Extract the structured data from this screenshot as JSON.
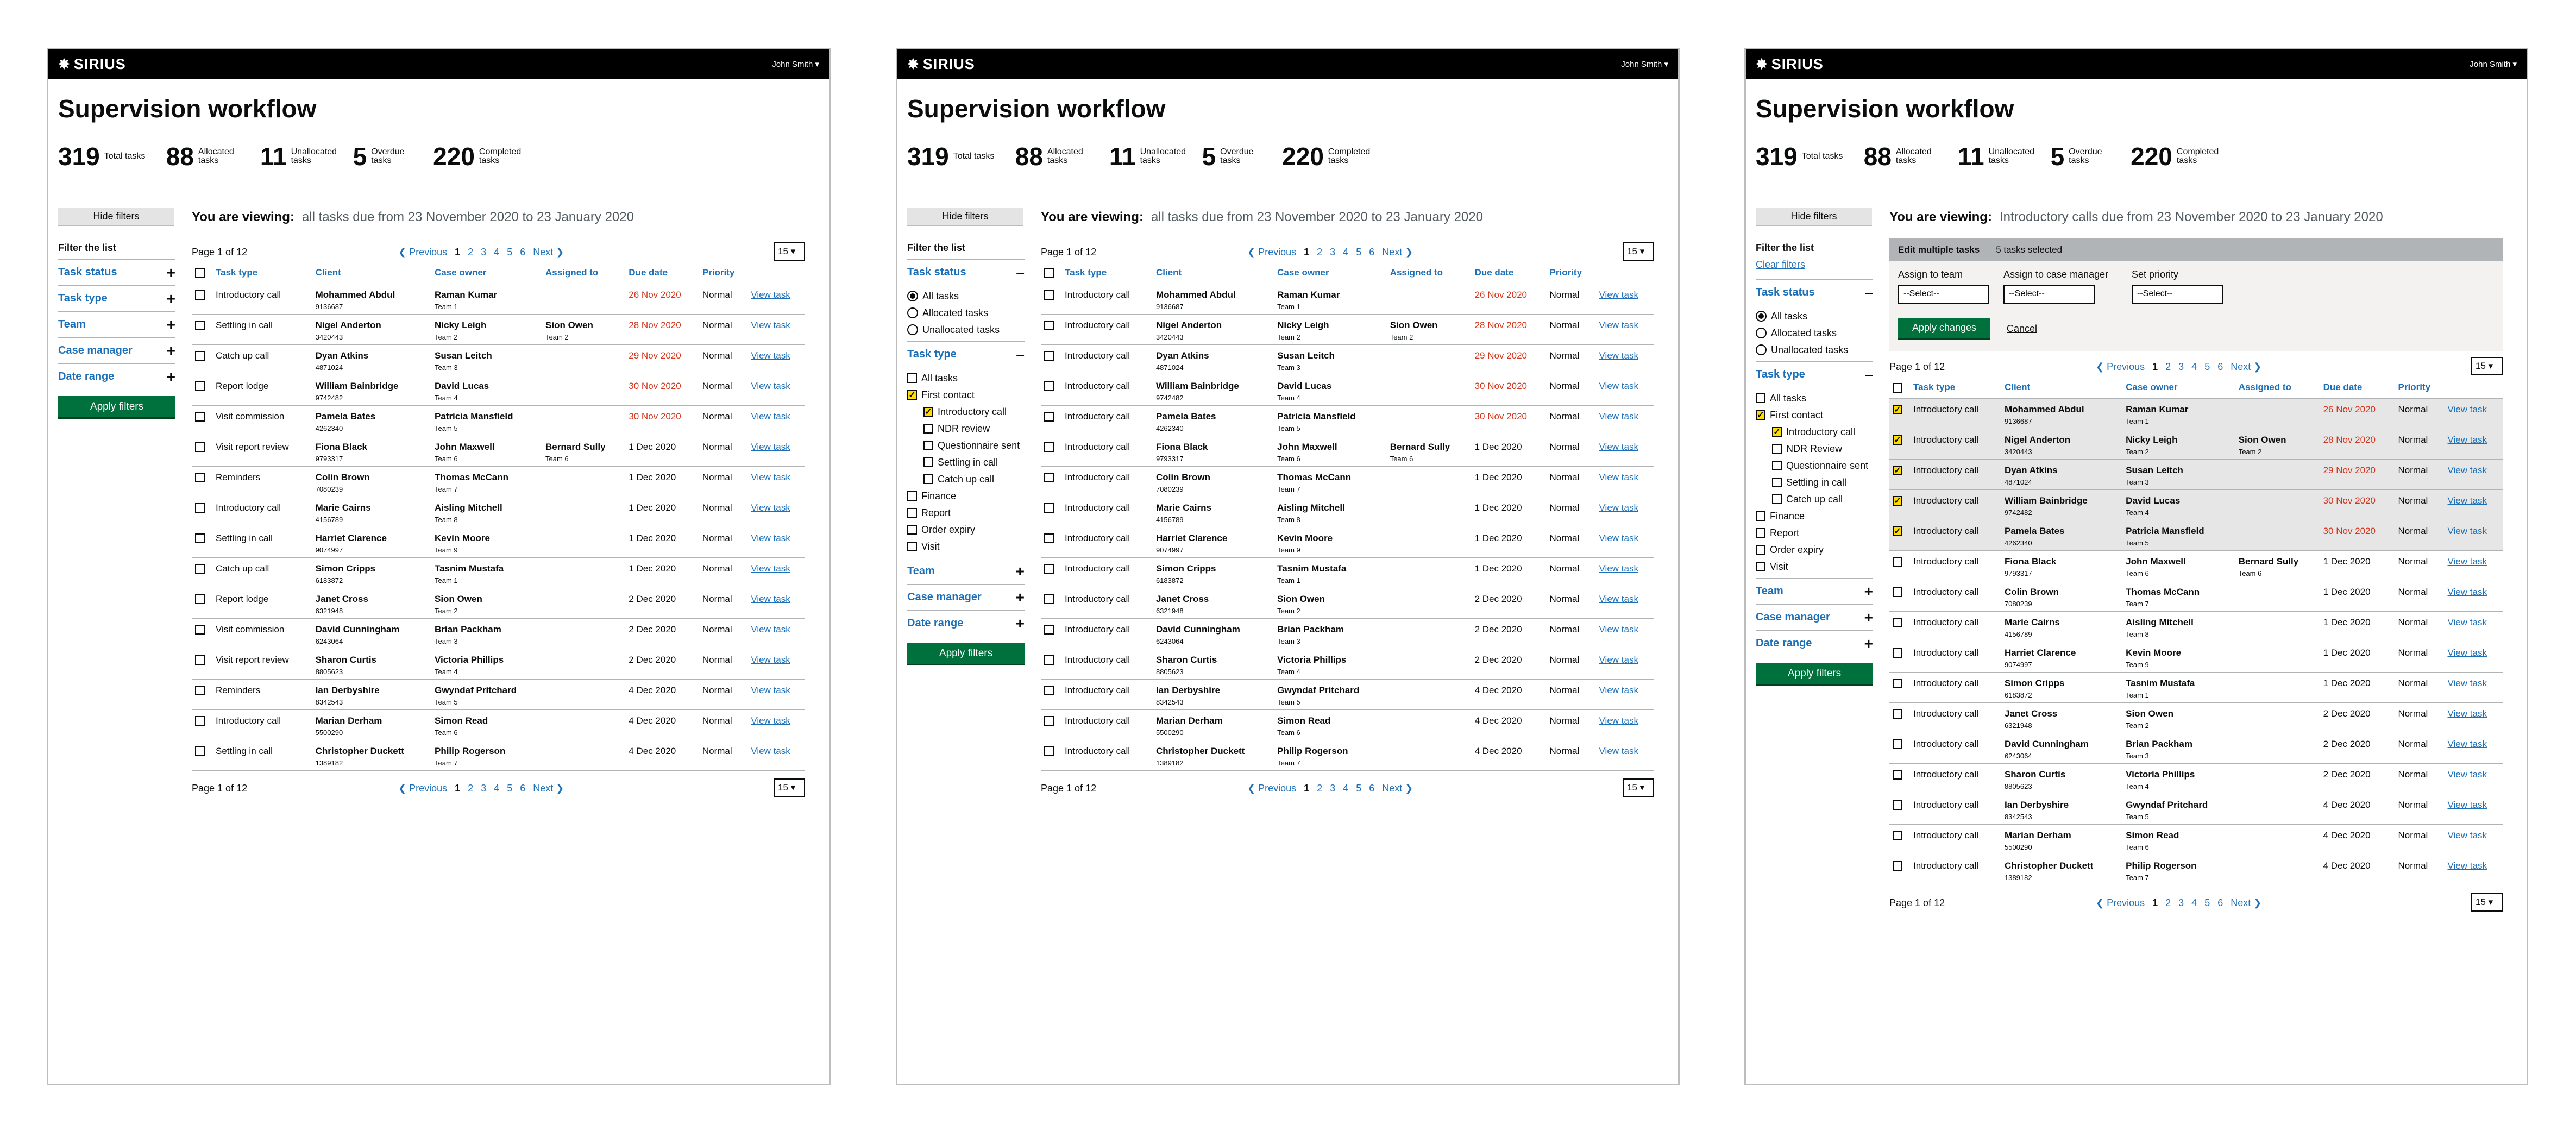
{
  "app": {
    "logo_mark": "✸",
    "logo_text": "SIRIUS",
    "user": "John Smith ▾"
  },
  "page_title": "Supervision workflow",
  "stats": [
    {
      "num": "319",
      "label": "Total tasks"
    },
    {
      "num": "88",
      "label": "Allocated tasks"
    },
    {
      "num": "11",
      "label": "Unallocated tasks"
    },
    {
      "num": "5",
      "label": "Overdue tasks"
    },
    {
      "num": "220",
      "label": "Completed tasks"
    }
  ],
  "hide_filters": "Hide filters",
  "viewing_label": "You are viewing:",
  "viewing_all": "all tasks due from 23 November 2020 to 23 January 2020",
  "viewing_intro": "Introductory calls due from 23 November 2020 to 23 January 2020",
  "filter_title": "Filter the list",
  "clear_filters": "Clear filters",
  "sections": {
    "status": "Task status",
    "type": "Task type",
    "team": "Team",
    "cm": "Case manager",
    "date": "Date range"
  },
  "status_opts": [
    "All tasks",
    "Allocated tasks",
    "Unallocated tasks"
  ],
  "type_opts": {
    "all": "All tasks",
    "first": "First contact",
    "intro": "Introductory call",
    "ndr2": "NDR review",
    "ndr3": "NDR Review",
    "quest": "Questionnaire sent",
    "settle": "Settling in call",
    "catch": "Catch up call",
    "finance": "Finance",
    "report": "Report",
    "order": "Order expiry",
    "visit": "Visit"
  },
  "apply_filters": "Apply filters",
  "pager": {
    "page": "Page 1 of 12",
    "prev": "❮ Previous",
    "pages": [
      "1",
      "2",
      "3",
      "4",
      "5",
      "6"
    ],
    "next": "Next ❯",
    "size": "15 ▾"
  },
  "headers": {
    "type": "Task type",
    "client": "Client",
    "owner": "Case owner",
    "assigned": "Assigned to",
    "due": "Due date",
    "priority": "Priority"
  },
  "view_task": "View task",
  "edit": {
    "title": "Edit multiple tasks",
    "selected": "5 tasks selected",
    "team": "Assign to team",
    "cm": "Assign to case manager",
    "priority": "Set priority",
    "select": "--Select--",
    "apply": "Apply changes",
    "cancel": "Cancel"
  },
  "rows": [
    {
      "type": "Introductory call",
      "client": "Mohammed Abdul",
      "id": "9136687",
      "owner": "Raman Kumar",
      "team": "Team 1",
      "assigned": "",
      "ateam": "",
      "due": "26 Nov 2020",
      "od": true,
      "prio": "Normal"
    },
    {
      "type": "Settling in call",
      "client": "Nigel Anderton",
      "id": "3420443",
      "owner": "Nicky Leigh",
      "team": "Team 2",
      "assigned": "Sion Owen",
      "ateam": "Team 2",
      "due": "28 Nov 2020",
      "od": true,
      "prio": "Normal"
    },
    {
      "type": "Catch up call",
      "client": "Dyan Atkins",
      "id": "4871024",
      "owner": "Susan Leitch",
      "team": "Team 3",
      "assigned": "",
      "ateam": "",
      "due": "29 Nov 2020",
      "od": true,
      "prio": "Normal"
    },
    {
      "type": "Report lodge",
      "client": "William Bainbridge",
      "id": "9742482",
      "owner": "David Lucas",
      "team": "Team 4",
      "assigned": "",
      "ateam": "",
      "due": "30 Nov 2020",
      "od": true,
      "prio": "Normal"
    },
    {
      "type": "Visit commission",
      "client": "Pamela Bates",
      "id": "4262340",
      "owner": "Patricia Mansfield",
      "team": "Team 5",
      "assigned": "",
      "ateam": "",
      "due": "30 Nov 2020",
      "od": true,
      "prio": "Normal"
    },
    {
      "type": "Visit report review",
      "client": "Fiona Black",
      "id": "9793317",
      "owner": "John Maxwell",
      "team": "Team 6",
      "assigned": "Bernard Sully",
      "ateam": "Team 6",
      "due": "1 Dec 2020",
      "od": false,
      "prio": "Normal"
    },
    {
      "type": "Reminders",
      "client": "Colin Brown",
      "id": "7080239",
      "owner": "Thomas McCann",
      "team": "Team 7",
      "assigned": "",
      "ateam": "",
      "due": "1 Dec 2020",
      "od": false,
      "prio": "Normal"
    },
    {
      "type": "Introductory call",
      "client": "Marie Cairns",
      "id": "4156789",
      "owner": "Aisling Mitchell",
      "team": "Team 8",
      "assigned": "",
      "ateam": "",
      "due": "1 Dec 2020",
      "od": false,
      "prio": "Normal"
    },
    {
      "type": "Settling in call",
      "client": "Harriet Clarence",
      "id": "9074997",
      "owner": "Kevin Moore",
      "team": "Team 9",
      "assigned": "",
      "ateam": "",
      "due": "1 Dec 2020",
      "od": false,
      "prio": "Normal"
    },
    {
      "type": "Catch up call",
      "client": "Simon Cripps",
      "id": "6183872",
      "owner": "Tasnim Mustafa",
      "team": "Team 1",
      "assigned": "",
      "ateam": "",
      "due": "1 Dec 2020",
      "od": false,
      "prio": "Normal"
    },
    {
      "type": "Report lodge",
      "client": "Janet Cross",
      "id": "6321948",
      "owner": "Sion Owen",
      "team": "Team 2",
      "assigned": "",
      "ateam": "",
      "due": "2 Dec 2020",
      "od": false,
      "prio": "Normal"
    },
    {
      "type": "Visit commission",
      "client": "David Cunningham",
      "id": "6243064",
      "owner": "Brian Packham",
      "team": "Team 3",
      "assigned": "",
      "ateam": "",
      "due": "2 Dec 2020",
      "od": false,
      "prio": "Normal"
    },
    {
      "type": "Visit report review",
      "client": "Sharon Curtis",
      "id": "8805623",
      "owner": "Victoria Phillips",
      "team": "Team 4",
      "assigned": "",
      "ateam": "",
      "due": "2 Dec 2020",
      "od": false,
      "prio": "Normal"
    },
    {
      "type": "Reminders",
      "client": "Ian Derbyshire",
      "id": "8342543",
      "owner": "Gwyndaf Pritchard",
      "team": "Team 5",
      "assigned": "",
      "ateam": "",
      "due": "4 Dec 2020",
      "od": false,
      "prio": "Normal"
    },
    {
      "type": "Introductory call",
      "client": "Marian Derham",
      "id": "5500290",
      "owner": "Simon Read",
      "team": "Team 6",
      "assigned": "",
      "ateam": "",
      "due": "4 Dec 2020",
      "od": false,
      "prio": "Normal"
    },
    {
      "type": "Settling in call",
      "client": "Christopher Duckett",
      "id": "1389182",
      "owner": "Philip Rogerson",
      "team": "Team 7",
      "assigned": "",
      "ateam": "",
      "due": "4 Dec 2020",
      "od": false,
      "prio": "Normal"
    }
  ]
}
